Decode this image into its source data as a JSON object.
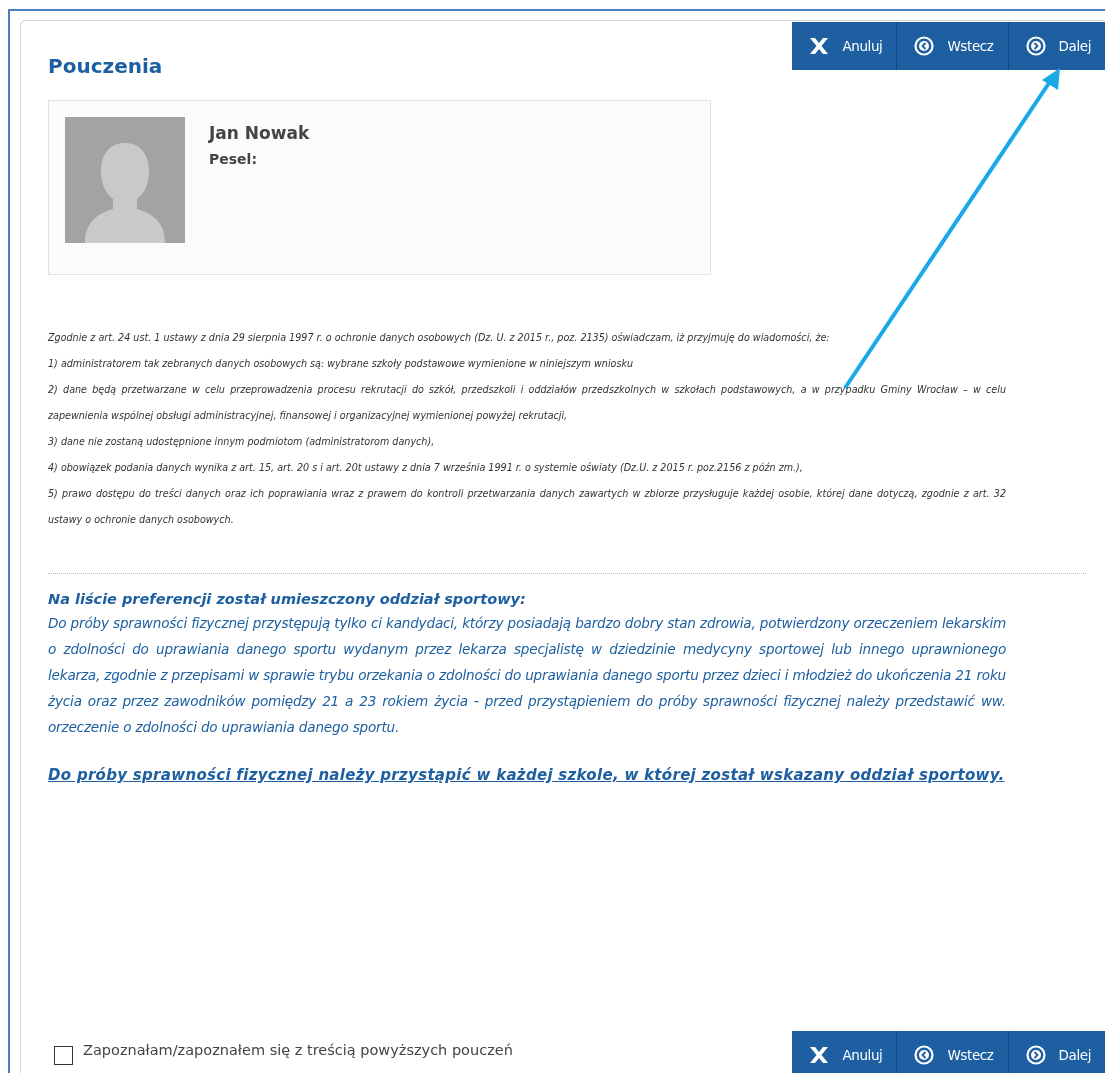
{
  "top_toolbar": [
    {
      "kind": "cancel",
      "label": "Anuluj"
    },
    {
      "kind": "back",
      "label": "Wstecz"
    },
    {
      "kind": "next",
      "label": "Dalej"
    }
  ],
  "title": "Pouczenia",
  "profile": {
    "name": "Jan Nowak",
    "pesel_label": "Pesel:"
  },
  "legal_notice": [
    "Zgodnie z art. 24 ust. 1 ustawy z dnia 29 sierpnia 1997 r. o ochronie danych osobowych (Dz. U. z 2015 r., poz. 2135) oświadczam, iż przyjmuję do wiadomości, że:",
    "1) administratorem tak zebranych danych osobowych są: wybrane szkoły podstawowe wymienione w niniejszym wniosku",
    "2) dane będą przetwarzane w celu przeprowadzenia procesu rekrutacji do szkół, przedszkoli i oddziałów przedszkolnych w szkołach podstawowych, a w przypadku Gminy Wrocław – w celu zapewnienia wspólnej obsługi administracyjnej, finansowej i organizacyjnej wymienionej powyżej rekrutacji,",
    "3) dane nie zostaną udostępnione innym podmiotom (administratorom danych),",
    "4) obowiązek podania danych wynika z art. 15, art. 20 s i art. 20t ustawy z dnia 7 września 1991 r. o systemie oświaty (Dz.U. z 2015 r. poz.2156 z późn zm.),",
    "5) prawo dostępu do treści danych oraz ich poprawiania wraz z prawem do kontroli przetwarzania danych zawartych w zbiorze przysługuje każdej osobie, której dane dotyczą, zgodnie z art. 32 ustawy o ochronie danych osobowych."
  ],
  "sports_notice": {
    "heading": "Na liście preferencji został umieszczony oddział sportowy:",
    "text": "Do próby sprawności fizycznej przystępują tylko ci kandydaci, którzy posiadają bardzo dobry stan zdrowia, potwierdzony orzeczeniem lekarskim o zdolności do uprawiania danego sportu wydanym przez lekarza specjalistę w dziedzinie medycyny sportowej lub innego uprawnionego lekarza, zgodnie z przepisami w sprawie trybu orzekania o zdolności do uprawiania danego sportu przez dzieci i młodzież do ukończenia 21 roku życia oraz przez zawodników pomiędzy 21 a 23 rokiem życia - przed przystąpieniem do próby sprawności fizycznej należy przedstawić ww. orzeczenie o zdolności do uprawiania danego sportu.",
    "emphasis": "Do próby sprawności fizycznej należy przystąpić w każdej szkole, w której został wskazany oddział sportowy."
  },
  "consent": {
    "label": "Zapoznałam/zapoznałem się z treścią powyższych pouczeń",
    "checked": false
  },
  "bottom_toolbar": [
    {
      "kind": "cancel",
      "label": "Anuluj"
    },
    {
      "kind": "back",
      "label": "Wstecz"
    },
    {
      "kind": "next",
      "label": "Dalej"
    }
  ]
}
